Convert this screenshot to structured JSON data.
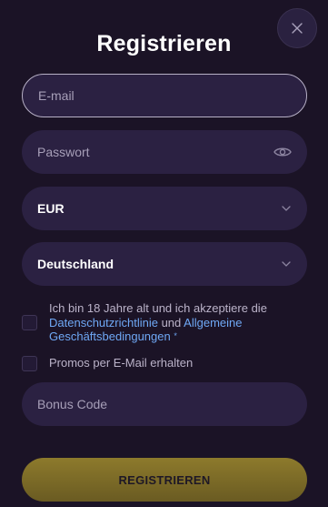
{
  "title": "Registrieren",
  "fields": {
    "email_placeholder": "E-mail",
    "password_placeholder": "Passwort",
    "currency_value": "EUR",
    "country_value": "Deutschland",
    "bonus_placeholder": "Bonus Code"
  },
  "terms": {
    "text_before": "Ich bin 18 Jahre alt und ich akzeptiere die ",
    "privacy_link": "Datenschutzrichtlinie",
    "text_and": " und ",
    "terms_link": "Allgemeine Geschäftsbedingungen",
    "required_mark": "*"
  },
  "promos_label": "Promos per E-Mail erhalten",
  "submit_label": "REGISTRIEREN",
  "colors": {
    "background": "#1b1326",
    "field": "#2b2142",
    "link": "#6fa8f5",
    "button": "#8d7a2c"
  },
  "icons": {
    "close": "close-icon",
    "password_visibility": "eye-icon",
    "dropdown": "chevron-down-icon"
  }
}
